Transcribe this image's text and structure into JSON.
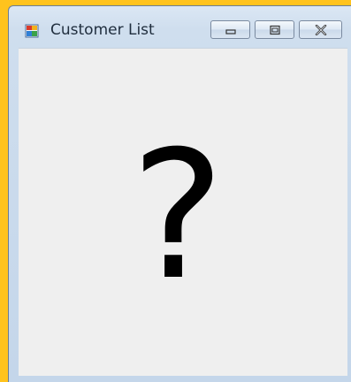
{
  "window": {
    "title": "Customer List",
    "icon": "application-form-icon",
    "caption_buttons": [
      "minimize",
      "maximize",
      "close"
    ]
  },
  "client": {
    "placeholder_glyph": "?"
  },
  "colors": {
    "desktop": "#ffc31d",
    "frame": "#cfdeee",
    "client_background": "#efefef"
  }
}
